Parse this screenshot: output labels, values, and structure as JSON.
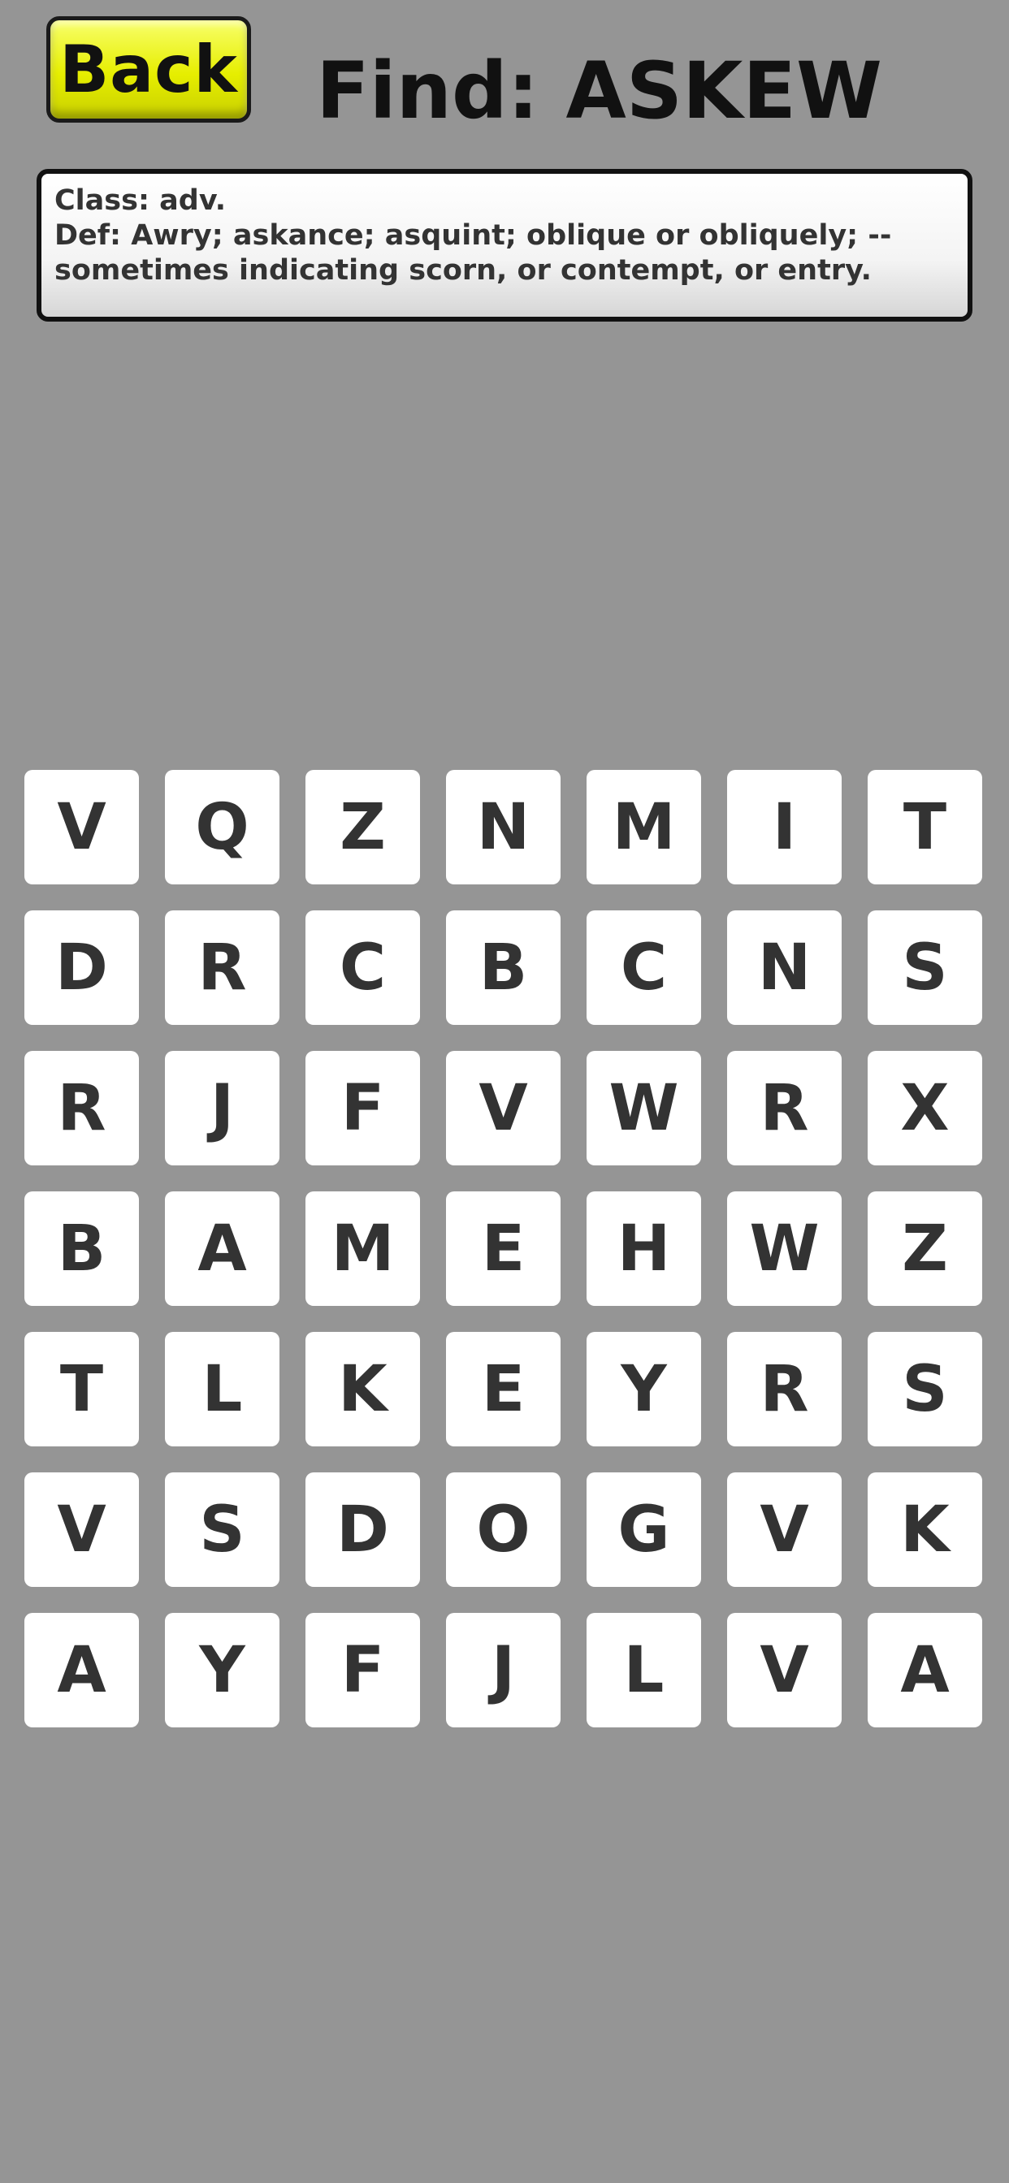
{
  "header": {
    "back_label": "Back",
    "find_text": "Find: ASKEW"
  },
  "definition": {
    "class_line": "Class: adv.",
    "def_line": "Def: Awry; askance; asquint; oblique or obliquely; -- sometimes indicating scorn, or contempt, or entry."
  },
  "grid": {
    "rows": [
      [
        "V",
        "Q",
        "Z",
        "N",
        "M",
        "I",
        "T"
      ],
      [
        "D",
        "R",
        "C",
        "B",
        "C",
        "N",
        "S"
      ],
      [
        "R",
        "J",
        "F",
        "V",
        "W",
        "R",
        "X"
      ],
      [
        "B",
        "A",
        "M",
        "E",
        "H",
        "W",
        "Z"
      ],
      [
        "T",
        "L",
        "K",
        "E",
        "Y",
        "R",
        "S"
      ],
      [
        "V",
        "S",
        "D",
        "O",
        "G",
        "V",
        "K"
      ],
      [
        "A",
        "Y",
        "F",
        "J",
        "L",
        "V",
        "A"
      ]
    ]
  },
  "colors": {
    "background": "#959595",
    "back_button": "#e6ee00",
    "tile": "#ffffff",
    "letter": "#333333"
  }
}
